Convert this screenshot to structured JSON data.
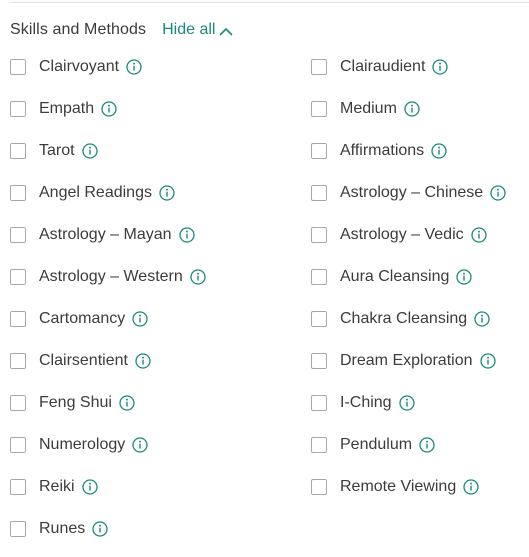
{
  "section": {
    "title": "Skills and Methods",
    "toggle_label": "Hide all"
  },
  "colors": {
    "accent": "#1a8a7b",
    "text": "#3c3c3c",
    "checkbox_border": "#a9a9a9"
  },
  "options": [
    {
      "label": "Clairvoyant",
      "checked": false
    },
    {
      "label": "Clairaudient",
      "checked": false
    },
    {
      "label": "Empath",
      "checked": false
    },
    {
      "label": "Medium",
      "checked": false
    },
    {
      "label": "Tarot",
      "checked": false
    },
    {
      "label": "Affirmations",
      "checked": false
    },
    {
      "label": "Angel Readings",
      "checked": false
    },
    {
      "label": "Astrology – Chinese",
      "checked": false
    },
    {
      "label": "Astrology – Mayan",
      "checked": false
    },
    {
      "label": "Astrology – Vedic",
      "checked": false
    },
    {
      "label": "Astrology – Western",
      "checked": false
    },
    {
      "label": "Aura Cleansing",
      "checked": false
    },
    {
      "label": "Cartomancy",
      "checked": false
    },
    {
      "label": "Chakra Cleansing",
      "checked": false
    },
    {
      "label": "Clairsentient",
      "checked": false
    },
    {
      "label": "Dream Exploration",
      "checked": false
    },
    {
      "label": "Feng Shui",
      "checked": false
    },
    {
      "label": "I-Ching",
      "checked": false
    },
    {
      "label": "Numerology",
      "checked": false
    },
    {
      "label": "Pendulum",
      "checked": false
    },
    {
      "label": "Reiki",
      "checked": false
    },
    {
      "label": "Remote Viewing",
      "checked": false
    },
    {
      "label": "Runes",
      "checked": false
    }
  ]
}
